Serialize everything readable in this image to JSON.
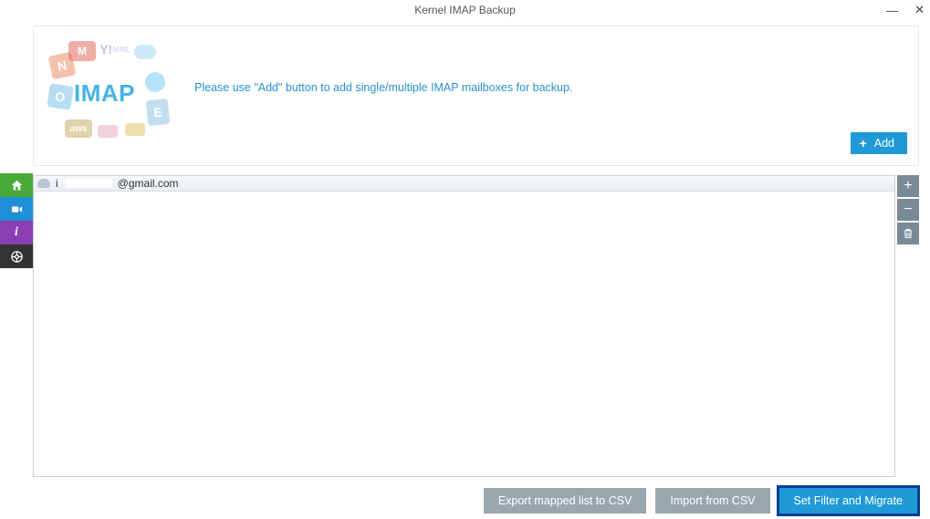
{
  "window": {
    "title": "Kernel IMAP Backup"
  },
  "brand": {
    "name": "Kernel"
  },
  "hero": {
    "imap_label": "IMAP",
    "instruction": "Please use \"Add\" button to add single/multiple IMAP mailboxes for backup.",
    "mail_caption": "MAIL",
    "add_button": "Add"
  },
  "sidebar": {
    "home": "home-icon",
    "video": "video-icon",
    "info": "info-icon",
    "help": "help-icon"
  },
  "mailbox_list": [
    {
      "email_suffix": "@gmail.com"
    }
  ],
  "list_actions": {
    "add_tooltip": "+",
    "remove_tooltip": "−",
    "delete_tooltip": "trash"
  },
  "footer": {
    "export_csv": "Export mapped list to CSV",
    "import_csv": "Import from CSV",
    "set_filter": "Set Filter and Migrate"
  },
  "colors": {
    "accent": "#1f9ad6",
    "accent_dark": "#0c3e92",
    "brand": "#0c6aa0"
  }
}
